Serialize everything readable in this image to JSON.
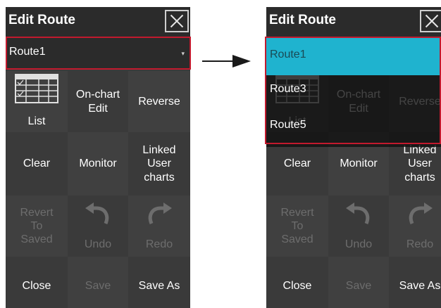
{
  "title": "Edit Route",
  "route_selected": "Route1",
  "dropdown_options": [
    "Route1",
    "Route3",
    "Route5"
  ],
  "buttons": {
    "list": "List",
    "on_chart_edit": "On-chart Edit",
    "reverse": "Reverse",
    "clear": "Clear",
    "monitor": "Monitor",
    "linked_user_charts": "Linked User charts",
    "revert_to_saved": "Revert To Saved",
    "undo": "Undo",
    "redo": "Redo",
    "close": "Close",
    "save": "Save",
    "save_as": "Save As"
  },
  "colors": {
    "panel_bg": "#3a3a3a",
    "header_bg": "#2b2b2b",
    "highlight_border": "#c21a2e",
    "selected_option": "#1fb3cf",
    "disabled_text": "#6d6d6d"
  }
}
